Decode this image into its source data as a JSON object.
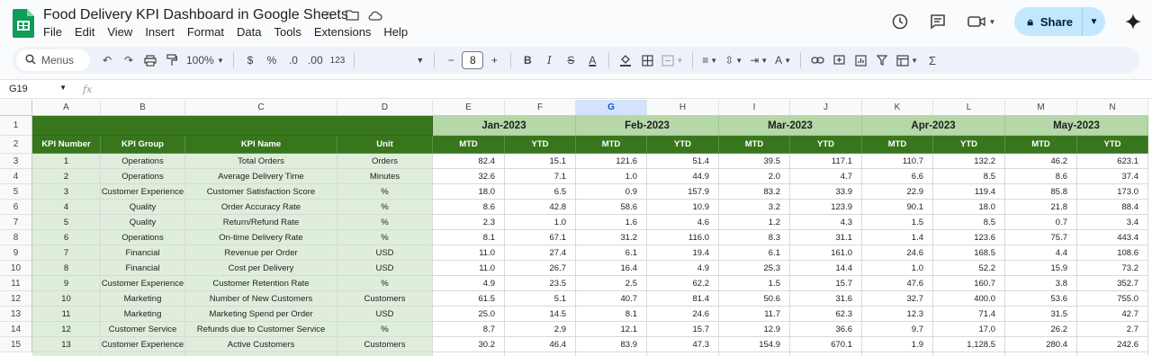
{
  "doc": {
    "title": "Food Delivery KPI Dashboard in Google Sheets",
    "share_label": "Share"
  },
  "menu": [
    "File",
    "Edit",
    "View",
    "Insert",
    "Format",
    "Data",
    "Tools",
    "Extensions",
    "Help"
  ],
  "toolbar": {
    "menus_label": "Menus",
    "zoom": "100%",
    "currency": "$",
    "percent": "%",
    "dec_decrease": ".0",
    "dec_increase": ".00",
    "number_format": "123",
    "font_size": "8"
  },
  "formula_bar": {
    "cell_ref": "G19",
    "fx": "fx",
    "value": ""
  },
  "columns": [
    "A",
    "B",
    "C",
    "D",
    "E",
    "F",
    "G",
    "H",
    "I",
    "J",
    "K",
    "L",
    "M",
    "N"
  ],
  "selected_column": "G",
  "rows": [
    "1",
    "2",
    "3",
    "4",
    "5",
    "6",
    "7",
    "8",
    "9",
    "10",
    "11",
    "12",
    "13",
    "14",
    "15"
  ],
  "months": [
    "Jan-2023",
    "Feb-2023",
    "Mar-2023",
    "Apr-2023",
    "May-2023"
  ],
  "headers": [
    "KPI Number",
    "KPI Group",
    "KPI Name",
    "Unit",
    "MTD",
    "YTD",
    "MTD",
    "YTD",
    "MTD",
    "YTD",
    "MTD",
    "YTD",
    "MTD",
    "YTD"
  ],
  "table": [
    [
      "1",
      "Operations",
      "Total Orders",
      "Orders",
      "82.4",
      "15.1",
      "121.6",
      "51.4",
      "39.5",
      "117.1",
      "110.7",
      "132.2",
      "46.2",
      "623.1"
    ],
    [
      "2",
      "Operations",
      "Average Delivery Time",
      "Minutes",
      "32.6",
      "7.1",
      "1.0",
      "44.9",
      "2.0",
      "4.7",
      "6.6",
      "8.5",
      "8.6",
      "37.4"
    ],
    [
      "3",
      "Customer Experience",
      "Customer Satisfaction Score",
      "%",
      "18.0",
      "6.5",
      "0.9",
      "157.9",
      "83.2",
      "33.9",
      "22.9",
      "119.4",
      "85.8",
      "173.0"
    ],
    [
      "4",
      "Quality",
      "Order Accuracy Rate",
      "%",
      "8.6",
      "42.8",
      "58.6",
      "10.9",
      "3.2",
      "123.9",
      "90.1",
      "18.0",
      "21.8",
      "88.4"
    ],
    [
      "5",
      "Quality",
      "Return/Refund Rate",
      "%",
      "2.3",
      "1.0",
      "1.6",
      "4.6",
      "1.2",
      "4.3",
      "1.5",
      "8.5",
      "0.7",
      "3.4"
    ],
    [
      "6",
      "Operations",
      "On-time Delivery Rate",
      "%",
      "8.1",
      "67.1",
      "31.2",
      "116.0",
      "8.3",
      "31.1",
      "1.4",
      "123.6",
      "75.7",
      "443.4"
    ],
    [
      "7",
      "Financial",
      "Revenue per Order",
      "USD",
      "11.0",
      "27.4",
      "6.1",
      "19.4",
      "6.1",
      "161.0",
      "24.6",
      "168.5",
      "4.4",
      "108.6"
    ],
    [
      "8",
      "Financial",
      "Cost per Delivery",
      "USD",
      "11.0",
      "26.7",
      "16.4",
      "4.9",
      "25.3",
      "14.4",
      "1.0",
      "52.2",
      "15.9",
      "73.2"
    ],
    [
      "9",
      "Customer Experience",
      "Customer Retention Rate",
      "%",
      "4.9",
      "23.5",
      "2.5",
      "62.2",
      "1.5",
      "15.7",
      "47.6",
      "160.7",
      "3.8",
      "352.7"
    ],
    [
      "10",
      "Marketing",
      "Number of New Customers",
      "Customers",
      "61.5",
      "5.1",
      "40.7",
      "81.4",
      "50.6",
      "31.6",
      "32.7",
      "400.0",
      "53.6",
      "755.0"
    ],
    [
      "11",
      "Marketing",
      "Marketing Spend per Order",
      "USD",
      "25.0",
      "14.5",
      "8.1",
      "24.6",
      "11.7",
      "62.3",
      "12.3",
      "71.4",
      "31.5",
      "42.7"
    ],
    [
      "12",
      "Customer Service",
      "Refunds due to Customer Service",
      "%",
      "8.7",
      "2.9",
      "12.1",
      "15.7",
      "12.9",
      "36.6",
      "9.7",
      "17.0",
      "26.2",
      "2.7"
    ],
    [
      "13",
      "Customer Experience",
      "Active Customers",
      "Customers",
      "30.2",
      "46.4",
      "83.9",
      "47.3",
      "154.9",
      "670.1",
      "1.9",
      "1,128.5",
      "280.4",
      "242.6"
    ]
  ]
}
